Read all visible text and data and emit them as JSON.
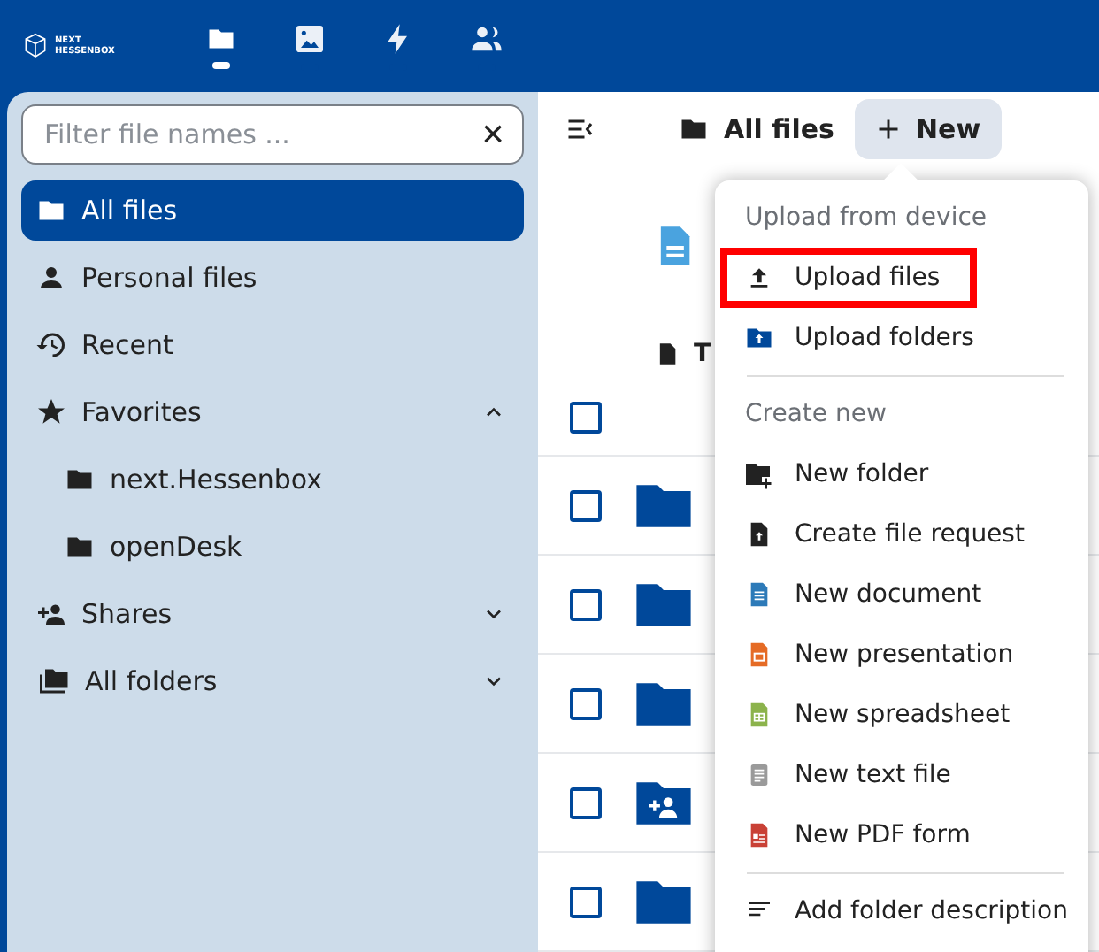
{
  "logo": {
    "line1": "NEXT",
    "line2": "HESSENBOX"
  },
  "top_nav": [
    {
      "kind": "folder",
      "selected": true
    },
    {
      "kind": "image",
      "selected": false
    },
    {
      "kind": "bolt",
      "selected": false
    },
    {
      "kind": "people",
      "selected": false
    }
  ],
  "sidebar": {
    "filter": {
      "placeholder": "Filter file names ...",
      "clear": "×"
    },
    "items": [
      {
        "label": "All files",
        "kind": "folder",
        "selected": true
      },
      {
        "label": "Personal files",
        "kind": "person",
        "selected": false
      },
      {
        "label": "Recent",
        "kind": "history",
        "selected": false
      },
      {
        "label": "Favorites",
        "kind": "star",
        "selected": false,
        "expanded": true,
        "children": [
          {
            "label": "next.Hessenbox",
            "kind": "folder",
            "selected": false
          },
          {
            "label": "openDesk",
            "kind": "folder",
            "selected": false
          }
        ]
      },
      {
        "label": "Shares",
        "kind": "share",
        "selected": false,
        "expanded": false
      },
      {
        "label": "All folders",
        "kind": "folders",
        "selected": false,
        "expanded": false
      }
    ]
  },
  "breadcrumb": {
    "label": "All files"
  },
  "new_button": {
    "label": "New"
  },
  "table": {
    "columns": [
      "T"
    ],
    "select_all_checked": false,
    "rows": [
      {
        "kind": "folder",
        "checked": false
      },
      {
        "kind": "folder",
        "checked": false
      },
      {
        "kind": "folder",
        "checked": false
      },
      {
        "kind": "shared",
        "checked": false
      },
      {
        "kind": "folder",
        "checked": false
      }
    ]
  },
  "menu": {
    "sections": [
      {
        "heading": "Upload from device",
        "items": [
          {
            "label": "Upload files",
            "kind": "upload",
            "highlighted": true
          },
          {
            "label": "Upload folders",
            "kind": "upload-folder",
            "highlighted": false
          }
        ]
      },
      {
        "heading": "Create new",
        "items": [
          {
            "label": "New folder",
            "kind": "new-folder",
            "highlighted": false
          },
          {
            "label": "Create file request",
            "kind": "file-request",
            "highlighted": false
          },
          {
            "label": "New document",
            "kind": "document",
            "highlighted": false
          },
          {
            "label": "New presentation",
            "kind": "presentation",
            "highlighted": false
          },
          {
            "label": "New spreadsheet",
            "kind": "spreadsheet",
            "highlighted": false
          },
          {
            "label": "New text file",
            "kind": "text",
            "highlighted": false
          },
          {
            "label": "New PDF form",
            "kind": "pdf",
            "highlighted": false
          }
        ]
      },
      {
        "items": [
          {
            "label": "Add folder description",
            "kind": "description",
            "highlighted": false
          }
        ]
      }
    ]
  }
}
